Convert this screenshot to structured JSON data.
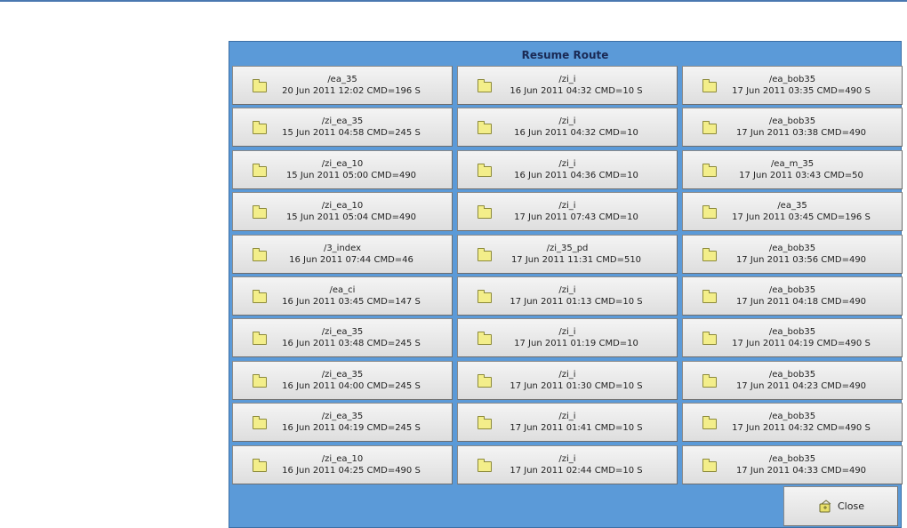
{
  "dialog": {
    "title": "Resume Route",
    "close_label": "Close"
  },
  "routes": [
    {
      "name": "/ea_35",
      "detail": "20 Jun 2011 12:02 CMD=196  S"
    },
    {
      "name": "/zi_i",
      "detail": "16 Jun 2011 04:32 CMD=10  S"
    },
    {
      "name": "/ea_bob35",
      "detail": "17 Jun 2011 03:35 CMD=490  S"
    },
    {
      "name": "/zi_ea_35",
      "detail": "15 Jun 2011 04:58 CMD=245  S"
    },
    {
      "name": "/zi_i",
      "detail": "16 Jun 2011 04:32 CMD=10"
    },
    {
      "name": "/ea_bob35",
      "detail": "17 Jun 2011 03:38 CMD=490"
    },
    {
      "name": "/zi_ea_10",
      "detail": "15 Jun 2011 05:00 CMD=490"
    },
    {
      "name": "/zi_i",
      "detail": "16 Jun 2011 04:36 CMD=10"
    },
    {
      "name": "/ea_m_35",
      "detail": "17 Jun 2011 03:43 CMD=50"
    },
    {
      "name": "/zi_ea_10",
      "detail": "15 Jun 2011 05:04 CMD=490"
    },
    {
      "name": "/zi_i",
      "detail": "17 Jun 2011 07:43 CMD=10"
    },
    {
      "name": "/ea_35",
      "detail": "17 Jun 2011 03:45 CMD=196  S"
    },
    {
      "name": "/3_index",
      "detail": "16 Jun 2011 07:44 CMD=46"
    },
    {
      "name": "/zi_35_pd",
      "detail": "17 Jun 2011 11:31 CMD=510"
    },
    {
      "name": "/ea_bob35",
      "detail": "17 Jun 2011 03:56 CMD=490"
    },
    {
      "name": "/ea_ci",
      "detail": "16 Jun 2011 03:45 CMD=147  S"
    },
    {
      "name": "/zi_i",
      "detail": "17 Jun 2011 01:13 CMD=10  S"
    },
    {
      "name": "/ea_bob35",
      "detail": "17 Jun 2011 04:18 CMD=490"
    },
    {
      "name": "/zi_ea_35",
      "detail": "16 Jun 2011 03:48 CMD=245  S"
    },
    {
      "name": "/zi_i",
      "detail": "17 Jun 2011 01:19 CMD=10"
    },
    {
      "name": "/ea_bob35",
      "detail": "17 Jun 2011 04:19 CMD=490  S"
    },
    {
      "name": "/zi_ea_35",
      "detail": "16 Jun 2011 04:00 CMD=245  S"
    },
    {
      "name": "/zi_i",
      "detail": "17 Jun 2011 01:30 CMD=10  S"
    },
    {
      "name": "/ea_bob35",
      "detail": "17 Jun 2011 04:23 CMD=490"
    },
    {
      "name": "/zi_ea_35",
      "detail": "16 Jun 2011 04:19 CMD=245  S"
    },
    {
      "name": "/zi_i",
      "detail": "17 Jun 2011 01:41 CMD=10  S"
    },
    {
      "name": "/ea_bob35",
      "detail": "17 Jun 2011 04:32 CMD=490  S"
    },
    {
      "name": "/zi_ea_10",
      "detail": "16 Jun 2011 04:25 CMD=490  S"
    },
    {
      "name": "/zi_i",
      "detail": "17 Jun 2011 02:44 CMD=10  S"
    },
    {
      "name": "/ea_bob35",
      "detail": "17 Jun 2011 04:33 CMD=490"
    }
  ],
  "icons": {
    "route": "folder-icon",
    "close": "close-icon"
  },
  "colors": {
    "dialog_background": "#5b9ad8",
    "title_text": "#1a2a55",
    "folder_fill": "#f3ee8a"
  }
}
